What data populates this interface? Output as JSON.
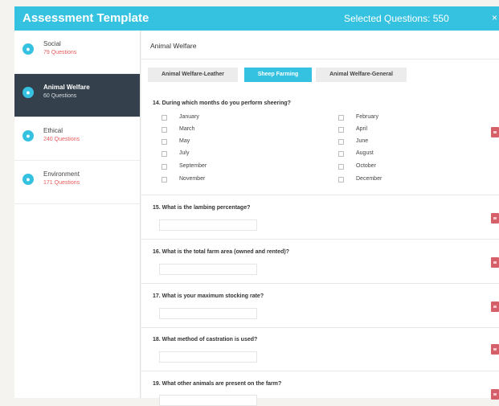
{
  "header": {
    "title": "Assessment Template",
    "selected_label": "Selected Questions: 550",
    "close_glyph": "×"
  },
  "colors": {
    "accent": "#35c2e0",
    "sidebar_active": "#34404c",
    "count_text": "#e85b5b",
    "delete_button": "#d6606a"
  },
  "sidebar": {
    "items": [
      {
        "name": "Social",
        "count": "79 Questions",
        "icon": "social-icon"
      },
      {
        "name": "Animal Welfare",
        "count": "60 Questions",
        "icon": "animal-welfare-icon"
      },
      {
        "name": "Ethical",
        "count": "240 Questions",
        "icon": "ethical-icon"
      },
      {
        "name": "Environment",
        "count": "171 Questions",
        "icon": "environment-icon"
      }
    ]
  },
  "main": {
    "section_title": "Animal Welfare",
    "tabs": [
      {
        "label": "Animal Welfare-Leather"
      },
      {
        "label": "Sheep Farming"
      },
      {
        "label": "Animal Welfare-General"
      }
    ],
    "questions": [
      {
        "text": "14. During which months do you perform sheering?",
        "options": [
          "January",
          "February",
          "March",
          "April",
          "May",
          "June",
          "July",
          "August",
          "September",
          "October",
          "November",
          "December"
        ]
      },
      {
        "text": "15. What is the lambing percentage?"
      },
      {
        "text": "16. What is the total farm area (owned and rented)?"
      },
      {
        "text": "17. What is your maximum stocking rate?"
      },
      {
        "text": "18. What method of castration is used?"
      },
      {
        "text": "19. What other animals are present on the farm?"
      }
    ]
  }
}
